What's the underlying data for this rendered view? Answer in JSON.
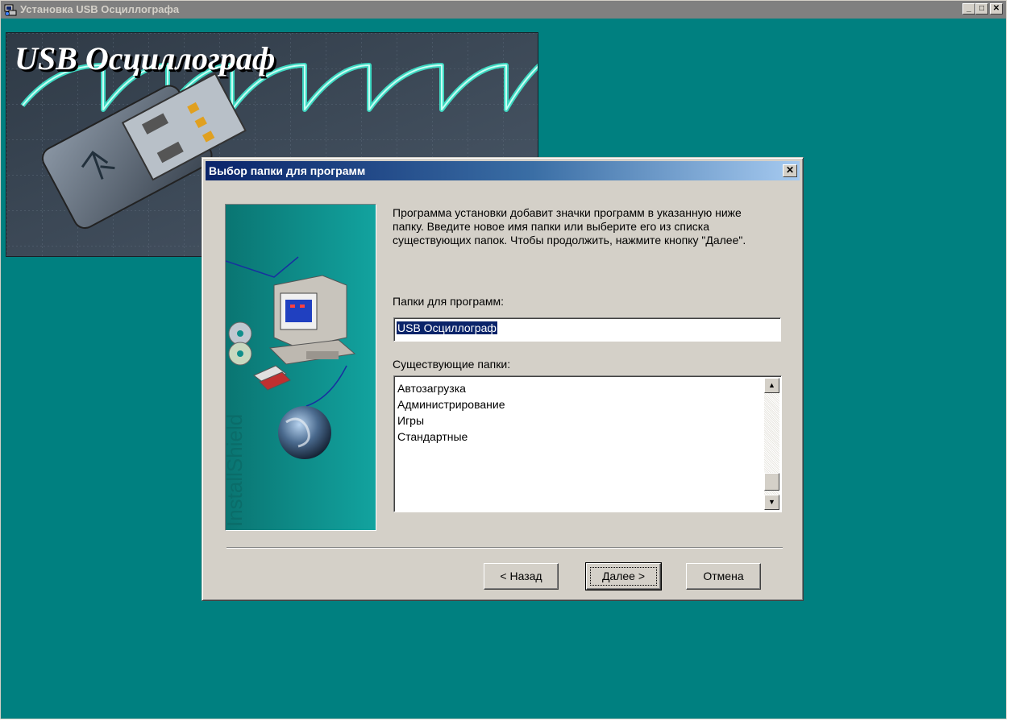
{
  "window": {
    "title": "Установка USB Осциллографа",
    "buttons": [
      "minimize",
      "maximize",
      "close"
    ]
  },
  "banner": {
    "title": "USB Осциллограф",
    "trace_color": "#3ee0c8"
  },
  "dialog": {
    "title": "Выбор папки для программ",
    "description": "Программа установки добавит значки программ в указанную ниже папку. Введите новое имя папки или выберите его из списка существующих папок. Чтобы продолжить, нажмите кнопку \"Далее\".",
    "folder_label": "Папки для программ:",
    "folder_value": "USB Осциллограф",
    "existing_label": "Существующие папки:",
    "existing_folders": [
      "Автозагрузка",
      "Администрирование",
      "Игры",
      "Стандартные"
    ],
    "side_watermark": "InstallShield",
    "buttons": {
      "back": "< Назад",
      "next": "Далее >",
      "cancel": "Отмена"
    }
  },
  "colors": {
    "desktop": "#008080",
    "dialog_face": "#d4d0c8",
    "title_active_start": "#0a246a",
    "title_active_end": "#a6caf0",
    "title_inactive": "#808080"
  }
}
